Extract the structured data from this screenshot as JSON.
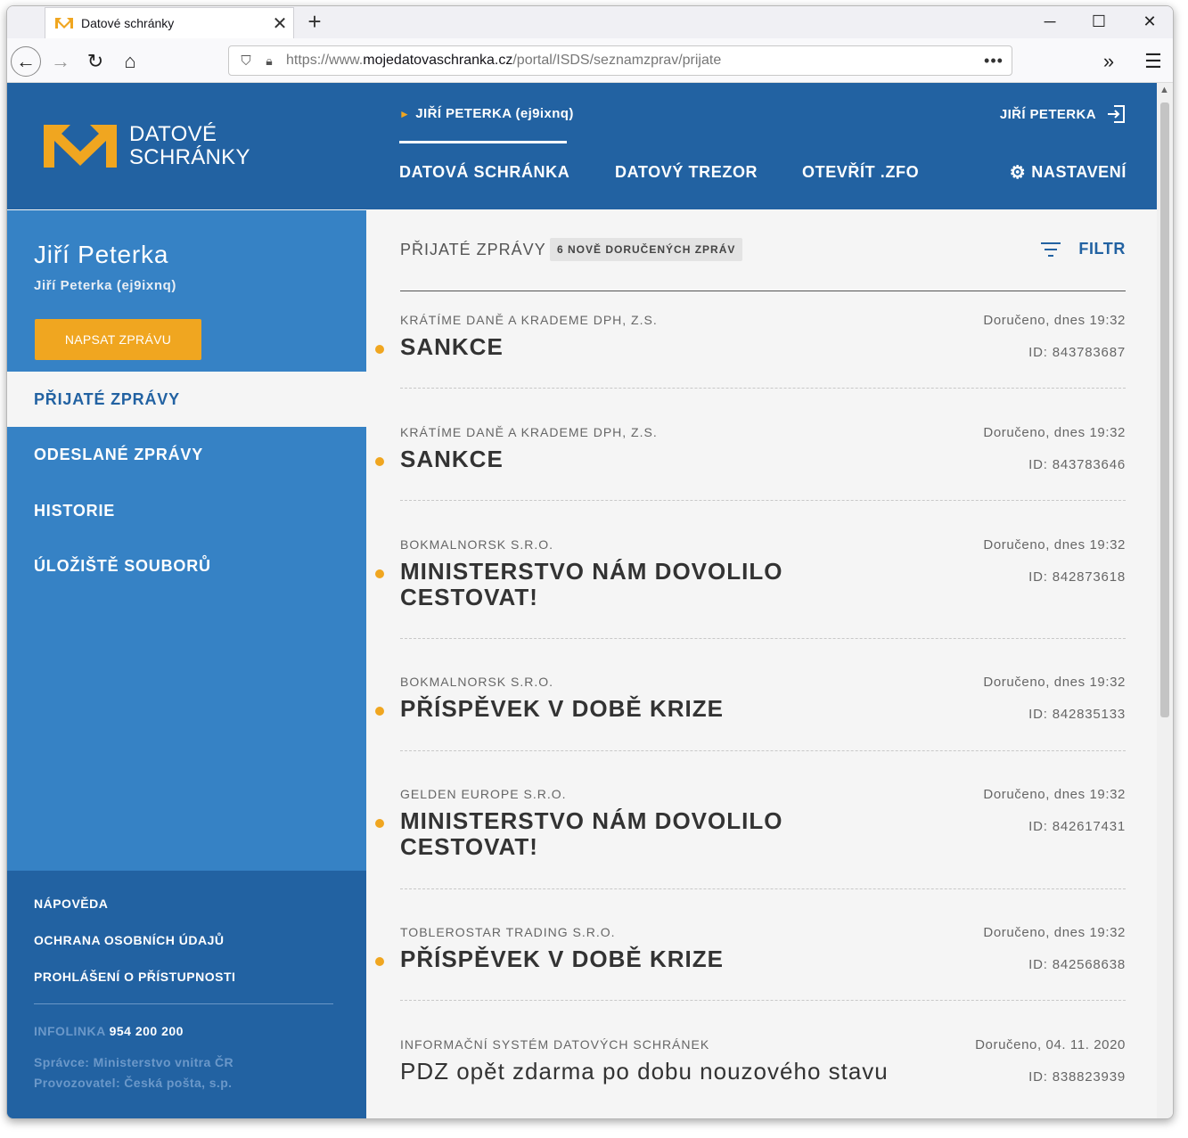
{
  "browser": {
    "tab_title": "Datové schránky",
    "url_prefix": "https://www.",
    "url_host": "mojedatovaschranka.cz",
    "url_path": "/portal/ISDS/seznamzprav/prijate",
    "more_dots": "•••",
    "overflow": "»",
    "menu": "☰"
  },
  "header": {
    "logo_line1": "DATOVÉ",
    "logo_line2": "SCHRÁNKY",
    "user_box": "JIŘÍ PETERKA (ej9ixnq)",
    "user_right": "JIŘÍ PETERKA",
    "nav": [
      "DATOVÁ SCHRÁNKA",
      "DATOVÝ TREZOR",
      "OTEVŘÍT .ZFO"
    ],
    "settings": "NASTAVENÍ",
    "accent": "#f0a620",
    "brand": "#2262a2"
  },
  "sidebar": {
    "name": "Jiří Peterka",
    "sub": "Jiří Peterka (ej9ixnq)",
    "compose": "NAPSAT ZPRÁVU",
    "items": [
      "PŘIJATÉ ZPRÁVY",
      "ODESLANÉ ZPRÁVY",
      "HISTORIE",
      "ÚLOŽIŠTĚ SOUBORŮ"
    ],
    "footer_links": [
      "NÁPOVĚDA",
      "OCHRANA OSOBNÍCH ÚDAJŮ",
      "PROHLÁŠENÍ O PŘÍSTUPNOSTI"
    ],
    "infolinka_label": "INFOLINKA",
    "infolinka_number": "954 200 200",
    "spravce": "Správce: Ministerstvo vnitra ČR",
    "provozovatel": "Provozovatel: Česká pošta, s.p."
  },
  "content": {
    "title": "PŘIJATÉ ZPRÁVY",
    "badge": "6 NOVĚ DORUČENÝCH ZPRÁV",
    "filter": "FILTR",
    "messages": [
      {
        "sender": "KRÁTÍME DANĚ A KRADEME DPH, Z.S.",
        "date": "Doručeno, dnes 19:32",
        "subject": "SANKCE",
        "id": "ID: 843783687"
      },
      {
        "sender": "KRÁTÍME DANĚ A KRADEME DPH, Z.S.",
        "date": "Doručeno, dnes 19:32",
        "subject": "SANKCE",
        "id": "ID: 843783646"
      },
      {
        "sender": "BOKMALNORSK S.R.O.",
        "date": "Doručeno, dnes 19:32",
        "subject": "MINISTERSTVO NÁM DOVOLILO CESTOVAT!",
        "id": "ID: 842873618"
      },
      {
        "sender": "BOKMALNORSK S.R.O.",
        "date": "Doručeno, dnes 19:32",
        "subject": "PŘÍSPĚVEK V DOBĚ KRIZE",
        "id": "ID: 842835133"
      },
      {
        "sender": "GELDEN EUROPE S.R.O.",
        "date": "Doručeno, dnes 19:32",
        "subject": "MINISTERSTVO NÁM DOVOLILO CESTOVAT!",
        "id": "ID: 842617431"
      },
      {
        "sender": "TOBLEROSTAR TRADING S.R.O.",
        "date": "Doručeno, dnes 19:32",
        "subject": "PŘÍSPĚVEK V DOBĚ KRIZE",
        "id": "ID: 842568638"
      },
      {
        "sender": "INFORMAČNÍ SYSTÉM DATOVÝCH SCHRÁNEK",
        "date": "Doručeno, 04. 11. 2020",
        "subject": "PDZ opět zdarma po dobu nouzového stavu",
        "id": "ID: 838823939"
      }
    ]
  }
}
